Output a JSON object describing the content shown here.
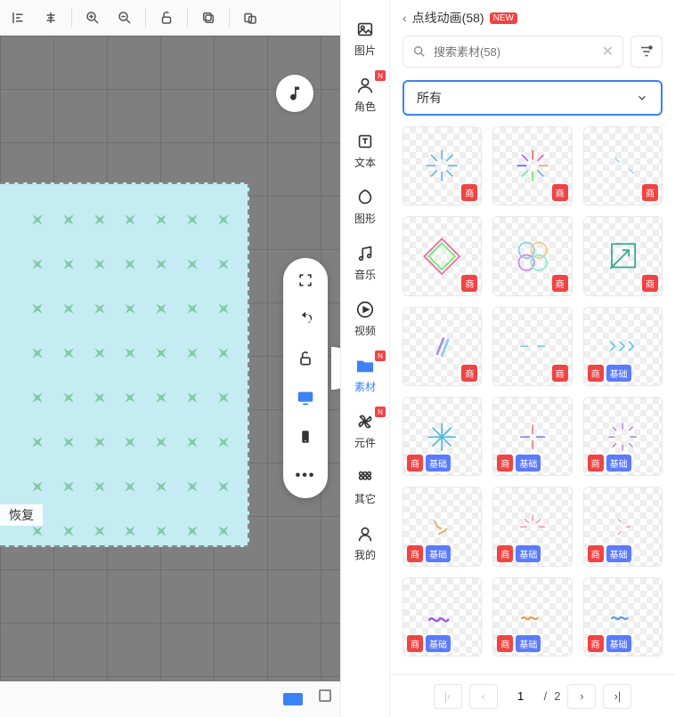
{
  "toolbar": {
    "icons": [
      "align-left",
      "align-center",
      "sep",
      "zoom-in",
      "zoom-out",
      "sep",
      "unlock",
      "sep",
      "copy",
      "sep",
      "paste-clone"
    ]
  },
  "canvas": {
    "restore_label": "恢复"
  },
  "float_tools": [
    {
      "name": "fullscreen",
      "active": false
    },
    {
      "name": "undo",
      "active": false
    },
    {
      "name": "unlock",
      "active": false
    },
    {
      "name": "display",
      "active": true
    },
    {
      "name": "phone",
      "active": false
    },
    {
      "name": "more",
      "active": false
    }
  ],
  "cat_rail": [
    {
      "label": "图片",
      "icon": "image",
      "badge": false
    },
    {
      "label": "角色",
      "icon": "user",
      "badge": true
    },
    {
      "label": "文本",
      "icon": "text",
      "badge": false
    },
    {
      "label": "图形",
      "icon": "shape",
      "badge": false
    },
    {
      "label": "音乐",
      "icon": "music",
      "badge": false
    },
    {
      "label": "视频",
      "icon": "video",
      "badge": false
    },
    {
      "label": "素材",
      "icon": "folder",
      "badge": true,
      "active": true
    },
    {
      "label": "元件",
      "icon": "pinwheel",
      "badge": true
    },
    {
      "label": "其它",
      "icon": "grid",
      "badge": false
    },
    {
      "label": "我的",
      "icon": "me",
      "badge": false
    }
  ],
  "panel": {
    "back_label": "点线动画(58)",
    "new_badge": "NEW",
    "search_placeholder": "搜索素材(58)",
    "type_select_label": "所有",
    "badge_shang": "商",
    "badge_jichu": "基础"
  },
  "assets": [
    {
      "id": 1,
      "preview": "burst-blue",
      "tags": [
        "shang"
      ]
    },
    {
      "id": 2,
      "preview": "burst-rainbow",
      "tags": [
        "shang"
      ]
    },
    {
      "id": 3,
      "preview": "line-sparse",
      "tags": [
        "shang"
      ]
    },
    {
      "id": 4,
      "preview": "diamond-rainbow",
      "tags": [
        "shang"
      ]
    },
    {
      "id": 5,
      "preview": "flower-rainbow",
      "tags": [
        "shang"
      ]
    },
    {
      "id": 6,
      "preview": "arrow-box",
      "tags": [
        "shang"
      ]
    },
    {
      "id": 7,
      "preview": "strokes",
      "tags": [
        "shang"
      ]
    },
    {
      "id": 8,
      "preview": "dash-thin",
      "tags": [
        "shang"
      ]
    },
    {
      "id": 9,
      "preview": "zigzag",
      "tags": [
        "shang",
        "jichu"
      ]
    },
    {
      "id": 10,
      "preview": "star-blue",
      "tags": [
        "shang",
        "jichu"
      ]
    },
    {
      "id": 11,
      "preview": "cross-plus",
      "tags": [
        "shang",
        "jichu"
      ]
    },
    {
      "id": 12,
      "preview": "burst-purple",
      "tags": [
        "shang",
        "jichu"
      ]
    },
    {
      "id": 13,
      "preview": "scribble-y",
      "tags": [
        "shang",
        "jichu"
      ]
    },
    {
      "id": 14,
      "preview": "burst-pink",
      "tags": [
        "shang",
        "jichu"
      ]
    },
    {
      "id": 15,
      "preview": "spark-tiny",
      "tags": [
        "shang",
        "jichu"
      ]
    },
    {
      "id": 16,
      "preview": "wave-purple",
      "tags": [
        "shang",
        "jichu"
      ]
    },
    {
      "id": 17,
      "preview": "wave-orange",
      "tags": [
        "shang",
        "jichu"
      ]
    },
    {
      "id": 18,
      "preview": "wave-blue",
      "tags": [
        "shang",
        "jichu"
      ]
    }
  ],
  "pager": {
    "current": "1",
    "total": "2",
    "sep": "/"
  }
}
